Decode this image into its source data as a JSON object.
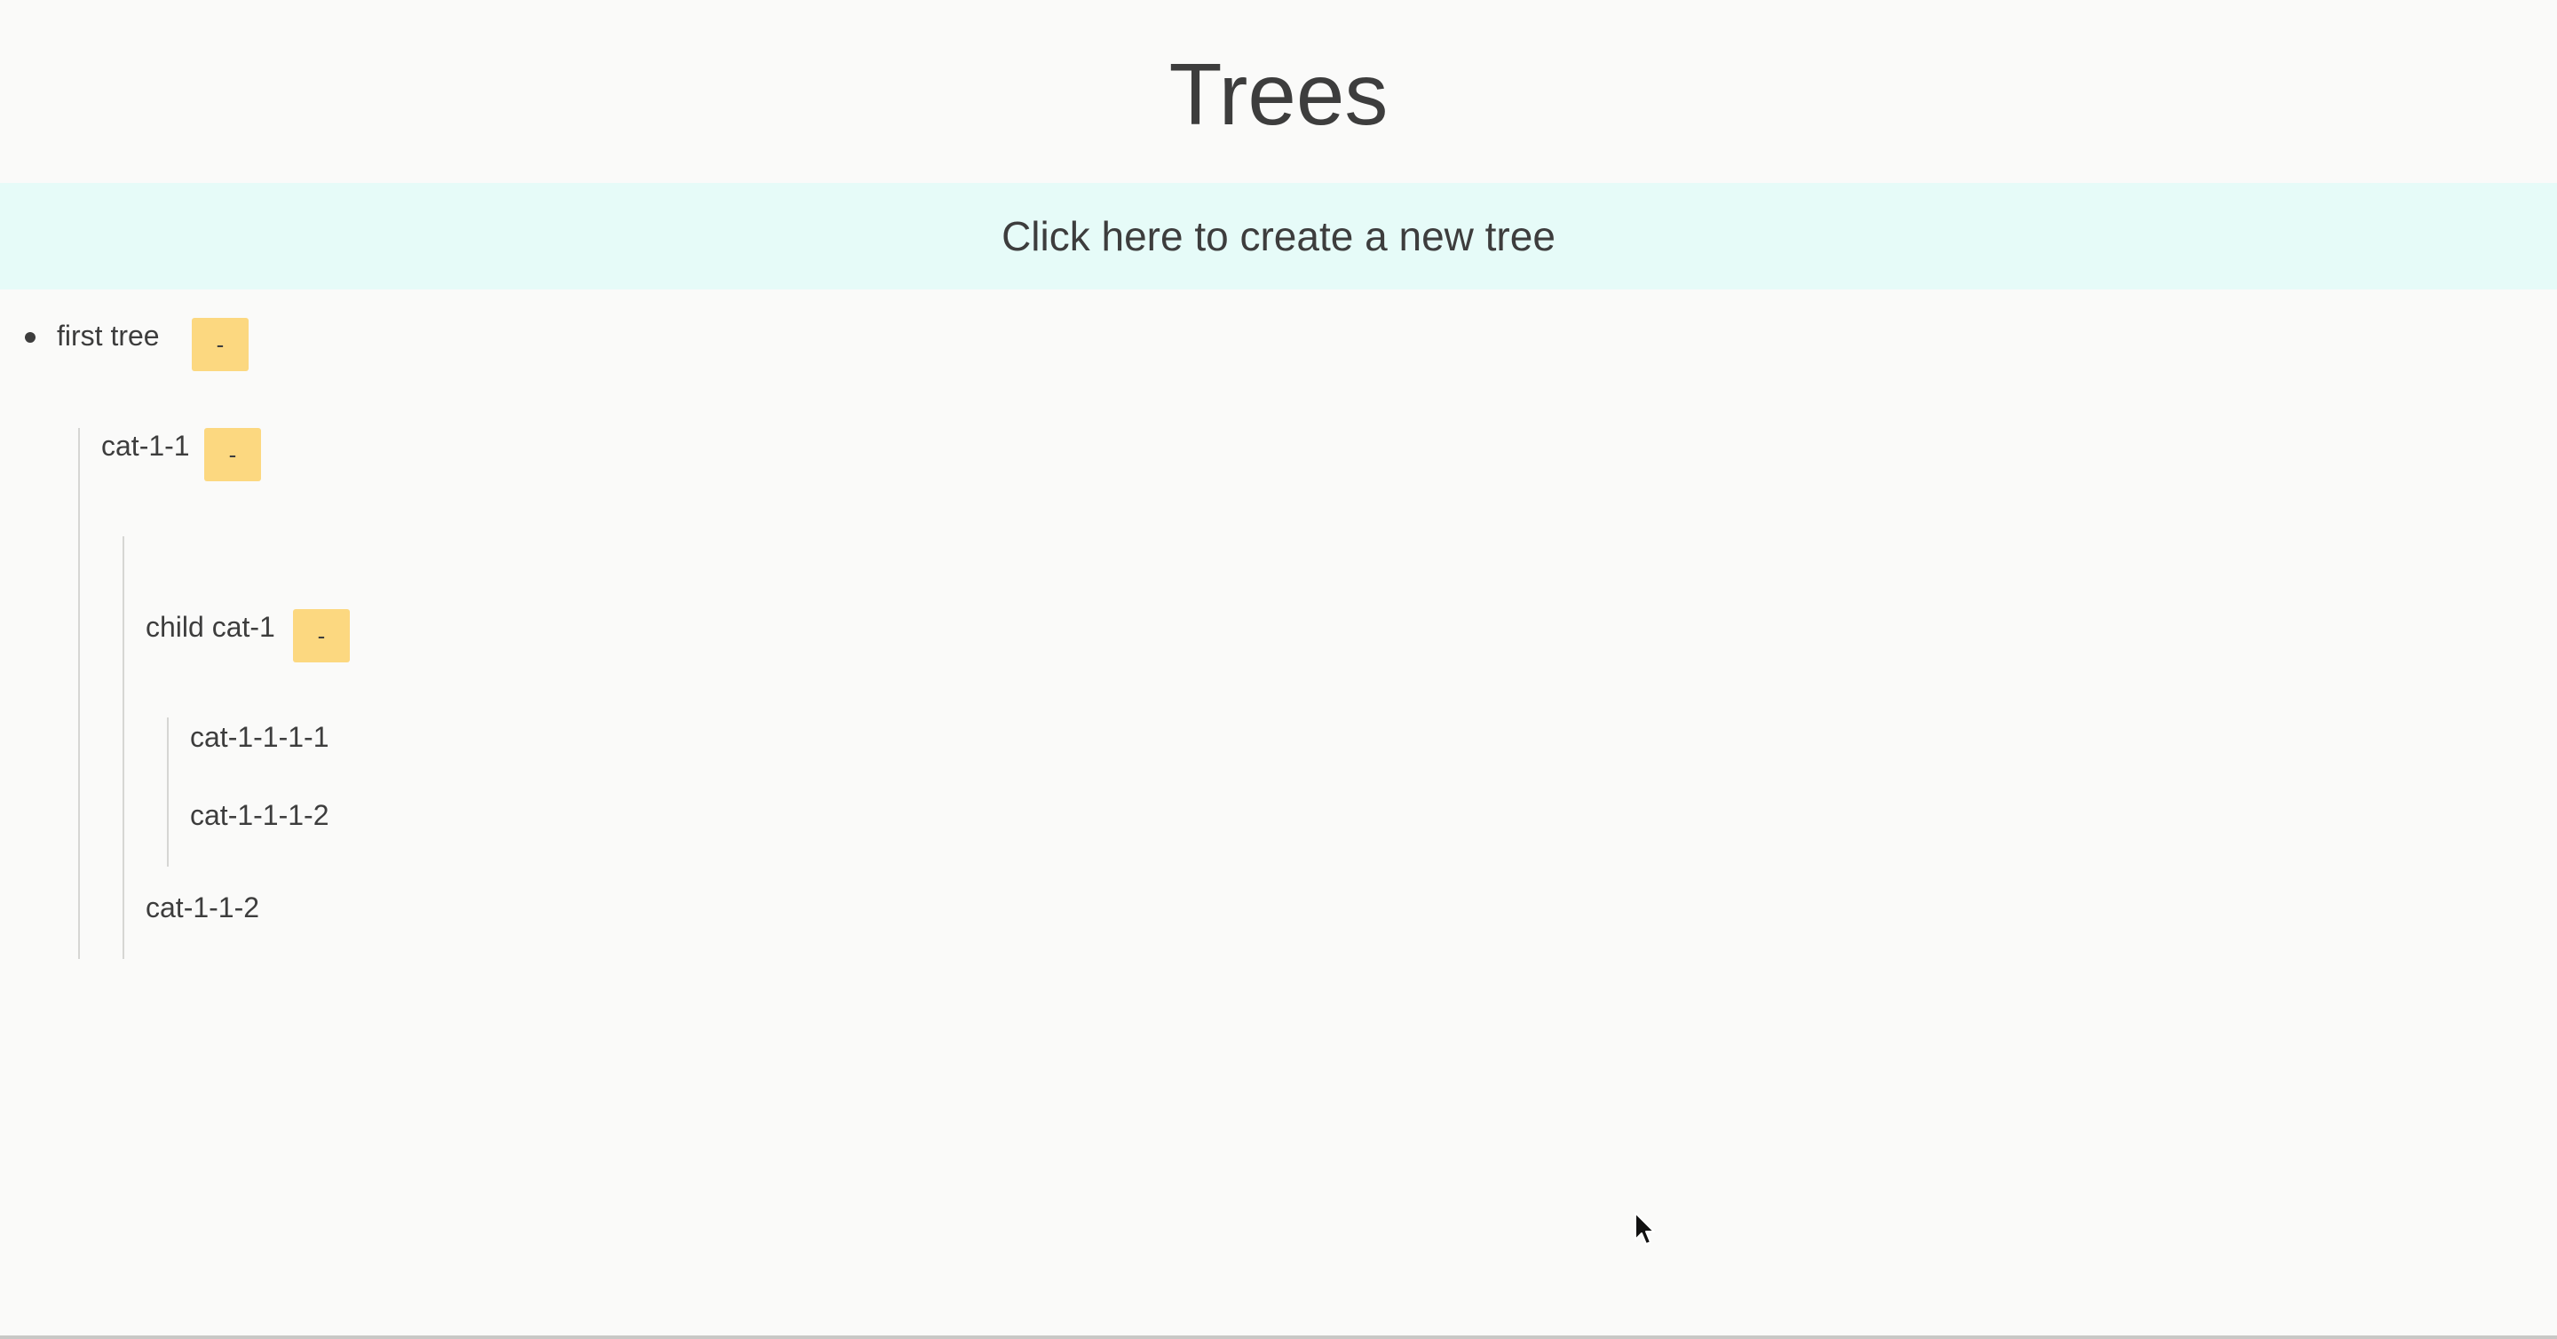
{
  "header": {
    "title": "Trees"
  },
  "create_banner": {
    "label": "Click here to create a new tree"
  },
  "tree": {
    "root": {
      "label": "first tree",
      "toggle": "-"
    },
    "cat_1_1": {
      "label": "cat-1-1",
      "toggle": "-"
    },
    "child_cat_1": {
      "label": "child cat-1",
      "toggle": "-"
    },
    "cat_1_1_1_1": {
      "label": "cat-1-1-1-1"
    },
    "cat_1_1_1_2": {
      "label": "cat-1-1-1-2"
    },
    "cat_1_1_2": {
      "label": "cat-1-1-2"
    }
  },
  "colors": {
    "banner": "#e6fbf8",
    "toggle_button": "#fcd880",
    "background": "#fafaf9",
    "text": "#3d3d3d"
  },
  "icons": {
    "cursor": "mouse-pointer-icon"
  }
}
